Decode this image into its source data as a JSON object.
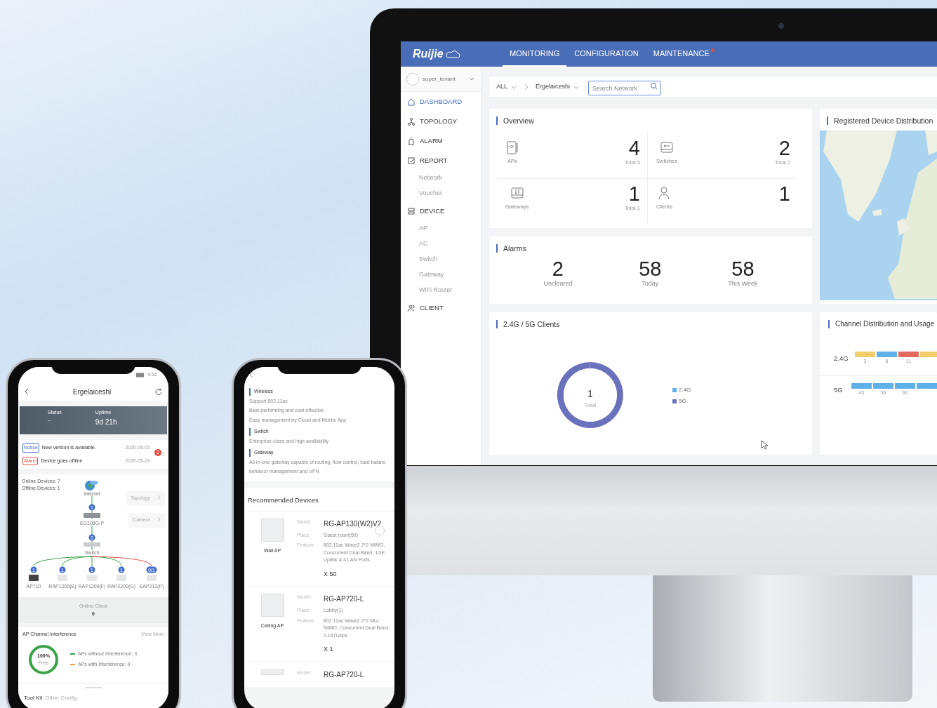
{
  "monitor": {
    "logo": "Ruijie",
    "nav": [
      {
        "label": "MONITORING",
        "selected": true,
        "alert": false
      },
      {
        "label": "CONFIGURATION",
        "selected": false,
        "alert": false
      },
      {
        "label": "MAINTENANCE",
        "selected": false,
        "alert": true
      }
    ],
    "user": {
      "name": "super_tenant"
    },
    "sidebar": [
      {
        "label": "DASHBOARD",
        "selected": true
      },
      {
        "label": "TOPOLOGY",
        "selected": false
      },
      {
        "label": "ALARM",
        "selected": false
      },
      {
        "label": "REPORT",
        "selected": false,
        "children": [
          {
            "label": "Network",
            "selected": false
          },
          {
            "label": "Voucher",
            "selected": false
          }
        ]
      },
      {
        "label": "DEVICE",
        "selected": false,
        "children": [
          {
            "label": "AP",
            "selected": false
          },
          {
            "label": "AC",
            "selected": false
          },
          {
            "label": "Switch",
            "selected": false
          },
          {
            "label": "Gateway",
            "selected": false
          },
          {
            "label": "WiFi Router",
            "selected": false
          }
        ]
      },
      {
        "label": "CLIENT",
        "selected": false
      }
    ],
    "breadcrumb": [
      {
        "label": "ALL"
      },
      {
        "label": "Ergelaiceshi"
      }
    ],
    "search": {
      "placeholder": "Search Network"
    },
    "overview": {
      "title": "Overview",
      "items": [
        {
          "label": "APs",
          "value": "4",
          "total": "Total 5"
        },
        {
          "label": "Switches",
          "value": "2",
          "total": "Total 2"
        },
        {
          "label": "Gateways",
          "value": "1",
          "total": "Total 1"
        },
        {
          "label": "Clients",
          "value": "1"
        }
      ]
    },
    "map": {
      "title": "Registered Device Distribution"
    },
    "alarms": {
      "title": "Alarms",
      "items": [
        {
          "value": "2",
          "label": "Uncleared"
        },
        {
          "value": "58",
          "label": "Today"
        },
        {
          "value": "58",
          "label": "This Week"
        }
      ]
    },
    "clients": {
      "title": "2.4G / 5G Clients",
      "center_value": "1",
      "center_label": "Total",
      "legend": [
        {
          "color": "#5fb0e8"
        },
        {
          "color": "#6b72bd"
        }
      ],
      "chart_data": {
        "type": "donut",
        "categories": [
          "2.4G",
          "5G"
        ],
        "values": [
          0,
          1
        ]
      }
    },
    "channels": {
      "title": "Channel Distribution and Usage",
      "rows": [
        {
          "band": "2.4G",
          "segments": [
            {
              "label": "3",
              "color": "#f2cd6b"
            },
            {
              "label": "6",
              "color": "#5fb0e8"
            },
            {
              "label": "11",
              "color": "#e2695e"
            },
            {
              "color": "#f2cd6b"
            }
          ]
        },
        {
          "band": "5G",
          "segments": [
            {
              "label": "40",
              "color": "#5fb0e8"
            },
            {
              "label": "56",
              "color": "#5fb0e8"
            },
            {
              "label": "60",
              "color": "#5fb0e8"
            },
            {
              "color": "#5fb0e8"
            }
          ]
        }
      ]
    }
  },
  "phone_left": {
    "time": "4:31",
    "title": "Ergelaiceshi",
    "banner": {
      "status_label": "Status",
      "status_value": "--",
      "uptime_label": "Uptime",
      "uptime_value": "9d 21h"
    },
    "messages": [
      {
        "kind": "notice",
        "tag": "Notice",
        "text": "New version is available.",
        "date": "2020-06-01"
      },
      {
        "kind": "alarm",
        "tag": "Alarm",
        "text": "Device goes offline",
        "date": "2020-05-29"
      }
    ],
    "message_count": "2",
    "online_devices": "Online Devices: 7",
    "offline_devices": "Offline Devices: 1",
    "links": [
      {
        "label": "Topology"
      },
      {
        "label": "Camera"
      }
    ],
    "topology": {
      "internet": "Internet",
      "gateway_badge": "1",
      "gateway": "EG105G-P",
      "switch_badge": "2",
      "switch": "Switch",
      "aps": [
        {
          "name": "AP710",
          "badge": "1",
          "online": true
        },
        {
          "name": "RAP1200(E)",
          "badge": "1",
          "online": true
        },
        {
          "name": "RAP1200(F)",
          "badge": "1",
          "online": true
        },
        {
          "name": "RAP2200(G)",
          "badge": "1",
          "online": true
        },
        {
          "name": "EAP212(F)",
          "badge": "0/1",
          "online": false
        }
      ]
    },
    "online_client_label": "Online Client",
    "online_client": "6",
    "interference": {
      "title": "AP Channel Interference",
      "link": "View More",
      "percent": "100%",
      "percent_label": "Free",
      "level": 1,
      "legend": [
        {
          "label": "APs without Interference: 3",
          "color": "#3aa346"
        },
        {
          "label": "APs with Interference: 0",
          "color": "#f0a23a"
        }
      ]
    },
    "tabs": [
      {
        "label": "Tool Kit",
        "selected": true
      },
      {
        "label": "Other Config",
        "selected": false
      }
    ]
  },
  "phone_right": {
    "sections": [
      {
        "title": "Wireless",
        "lines": [
          "Support 802.11ac",
          "Best-performing and cost-effective",
          "Easy management by Cloud and Mobile App"
        ]
      },
      {
        "title": "Switch",
        "lines": [
          "Enterprise-class and high availability"
        ]
      },
      {
        "title": "Gateway",
        "lines": [
          "All-in-one gateway capable of routing, flow control, load balanc",
          "behavior management and VPN"
        ]
      }
    ],
    "recommended_title": "Recommended Devices",
    "devices": [
      {
        "type": "Wall AP",
        "selected": false,
        "quantity": "X 50",
        "fields": [
          {
            "kind": "model",
            "label": "Model:",
            "value": "RG-AP130(W2)V2"
          },
          {
            "kind": "place",
            "label": "Place:",
            "value": "Guest room(50)"
          },
          {
            "kind": "feature",
            "label": "Feature:",
            "value": "802.11ac Wave2 2*2 MIMO, Concurrent Dual Band, 1GE Uplink & 4 LAN Ports"
          }
        ]
      },
      {
        "type": "Ceiling AP",
        "quantity": "X 1",
        "fields": [
          {
            "kind": "model",
            "label": "Model:",
            "value": "RG-AP720-L"
          },
          {
            "kind": "place",
            "label": "Place:",
            "value": "Lobby(1)"
          },
          {
            "kind": "feature",
            "label": "Feature:",
            "value": "802.11ac Wave2 2*2 MU-MIMO, Concurrent Dual Band, 1.167Gbps"
          }
        ]
      },
      {
        "fields": [
          {
            "kind": "model",
            "label": "Model:",
            "value": "RG-AP720-L"
          }
        ]
      }
    ]
  }
}
